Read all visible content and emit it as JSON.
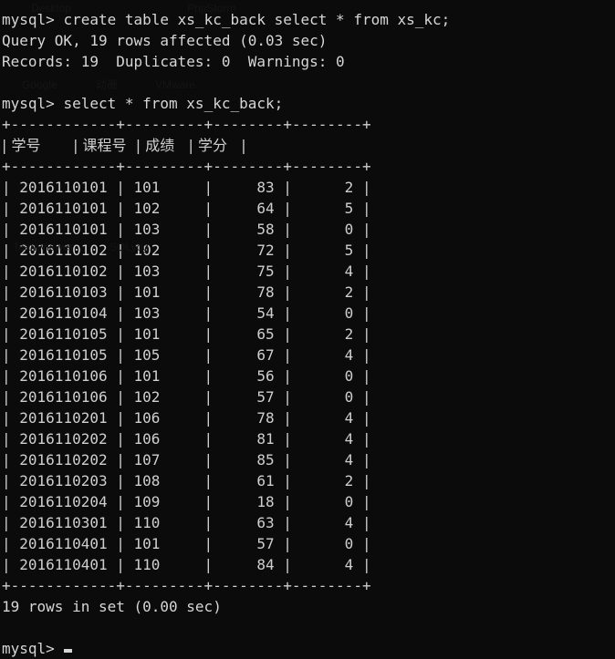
{
  "terminal": {
    "background_color": "#0b0b0b",
    "text_color": "#d6d6d6",
    "prompt": "mysql> ",
    "cursor_glyph": "_"
  },
  "session": {
    "command_1": "create table xs_kc_back select * from xs_kc;",
    "result_1_line_1": "Query OK, 19 rows affected (0.03 sec)",
    "result_1_line_2": "Records: 19  Duplicates: 0  Warnings: 0",
    "command_2": "select * from xs_kc_back;",
    "result_2_footer": "19 rows in set (0.00 sec)"
  },
  "table": {
    "separator": "+------------+---------+--------+--------+",
    "header_row": "| 学号       | 课程号  | 成绩   | 学分   |",
    "columns": [
      {
        "label": "学号",
        "width": 12,
        "align": "left"
      },
      {
        "label": "课程号",
        "width": 9,
        "align": "left"
      },
      {
        "label": "成绩",
        "width": 8,
        "align": "right"
      },
      {
        "label": "学分",
        "width": 8,
        "align": "right"
      }
    ],
    "rows": [
      {
        "line": "| 2016110101 | 101     |     83 |      2 |",
        "xh": "2016110101",
        "kch": "101",
        "cj": "83",
        "xf": "2"
      },
      {
        "line": "| 2016110101 | 102     |     64 |      5 |",
        "xh": "2016110101",
        "kch": "102",
        "cj": "64",
        "xf": "5"
      },
      {
        "line": "| 2016110101 | 103     |     58 |      0 |",
        "xh": "2016110101",
        "kch": "103",
        "cj": "58",
        "xf": "0"
      },
      {
        "line": "| 2016110102 | 102     |     72 |      5 |",
        "xh": "2016110102",
        "kch": "102",
        "cj": "72",
        "xf": "5"
      },
      {
        "line": "| 2016110102 | 103     |     75 |      4 |",
        "xh": "2016110102",
        "kch": "103",
        "cj": "75",
        "xf": "4"
      },
      {
        "line": "| 2016110103 | 101     |     78 |      2 |",
        "xh": "2016110103",
        "kch": "101",
        "cj": "78",
        "xf": "2"
      },
      {
        "line": "| 2016110104 | 103     |     54 |      0 |",
        "xh": "2016110104",
        "kch": "103",
        "cj": "54",
        "xf": "0"
      },
      {
        "line": "| 2016110105 | 101     |     65 |      2 |",
        "xh": "2016110105",
        "kch": "101",
        "cj": "65",
        "xf": "2"
      },
      {
        "line": "| 2016110105 | 105     |     67 |      4 |",
        "xh": "2016110105",
        "kch": "105",
        "cj": "67",
        "xf": "4"
      },
      {
        "line": "| 2016110106 | 101     |     56 |      0 |",
        "xh": "2016110106",
        "kch": "101",
        "cj": "56",
        "xf": "0"
      },
      {
        "line": "| 2016110106 | 102     |     57 |      0 |",
        "xh": "2016110106",
        "kch": "102",
        "cj": "57",
        "xf": "0"
      },
      {
        "line": "| 2016110201 | 106     |     78 |      4 |",
        "xh": "2016110201",
        "kch": "106",
        "cj": "78",
        "xf": "4"
      },
      {
        "line": "| 2016110202 | 106     |     81 |      4 |",
        "xh": "2016110202",
        "kch": "106",
        "cj": "81",
        "xf": "4"
      },
      {
        "line": "| 2016110202 | 107     |     85 |      4 |",
        "xh": "2016110202",
        "kch": "107",
        "cj": "85",
        "xf": "4"
      },
      {
        "line": "| 2016110203 | 108     |     61 |      2 |",
        "xh": "2016110203",
        "kch": "108",
        "cj": "61",
        "xf": "2"
      },
      {
        "line": "| 2016110204 | 109     |     18 |      0 |",
        "xh": "2016110204",
        "kch": "109",
        "cj": "18",
        "xf": "0"
      },
      {
        "line": "| 2016110301 | 110     |     63 |      4 |",
        "xh": "2016110301",
        "kch": "110",
        "cj": "63",
        "xf": "4"
      },
      {
        "line": "| 2016110401 | 101     |     57 |      0 |",
        "xh": "2016110401",
        "kch": "101",
        "cj": "57",
        "xf": "0"
      },
      {
        "line": "| 2016110401 | 110     |     84 |      4 |",
        "xh": "2016110401",
        "kch": "110",
        "cj": "84",
        "xf": "4"
      }
    ]
  },
  "watermarks": {
    "w1": "Desktop",
    "w2": "PhpStorm",
    "w3": "Google",
    "w4": "动画",
    "w5": "VMware",
    "w6": "TeamViewer",
    "w7": "SQLyog"
  }
}
